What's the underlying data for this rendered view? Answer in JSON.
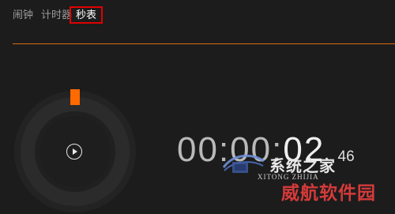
{
  "tabs": {
    "alarm": "闹钟",
    "timer": "计时器",
    "stopwatch": "秒表"
  },
  "colors": {
    "background": "#1c1c1c",
    "accent": "#ff6a00",
    "tab_highlight": "#e00000",
    "watermark_red": "#d43a3a"
  },
  "dial": {
    "progress_fraction": 0.025,
    "play_icon": "play-icon"
  },
  "stopwatch": {
    "main": "00:00:02",
    "hhmm": "00:00:",
    "seconds": "02",
    "centiseconds": "46"
  },
  "watermark": {
    "site_name": "系统之家",
    "site_subtext": "XITONG ZHIJIA",
    "brand": "威航软件园"
  }
}
